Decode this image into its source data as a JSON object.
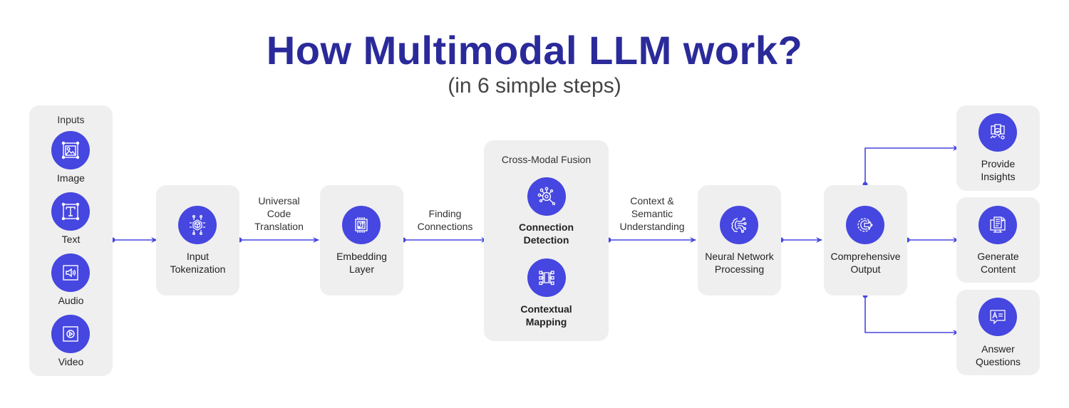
{
  "title": "How Multimodal LLM work?",
  "subtitle": "(in 6 simple steps)",
  "accent_color": "#4646e0",
  "title_color": "#2a2a9a",
  "inputs": {
    "header": "Inputs",
    "items": [
      {
        "label": "Image",
        "icon": "image-icon"
      },
      {
        "label": "Text",
        "icon": "text-icon"
      },
      {
        "label": "Audio",
        "icon": "audio-icon"
      },
      {
        "label": "Video",
        "icon": "video-icon"
      }
    ]
  },
  "steps": {
    "tokenization": {
      "line1": "Input",
      "line2": "Tokenization",
      "icon": "chip-cube-icon"
    },
    "embedding": {
      "line1": "Embedding",
      "line2": "Layer",
      "icon": "processor-icon"
    },
    "fusion": {
      "header": "Cross-Modal Fusion",
      "detection": {
        "line1": "Connection",
        "line2": "Detection",
        "icon": "network-search-icon"
      },
      "mapping": {
        "line1": "Contextual",
        "line2": "Mapping",
        "icon": "mapping-icon"
      }
    },
    "neural": {
      "line1": "Neural Network",
      "line2": "Processing",
      "icon": "neural-brain-icon"
    },
    "output": {
      "line1": "Comprehensive",
      "line2": "Output",
      "icon": "gear-arrow-icon"
    }
  },
  "edges": {
    "e1": {
      "line1": "Universal",
      "line2": "Code",
      "line3": "Translation"
    },
    "e2": {
      "line1": "Finding",
      "line2": "Connections"
    },
    "e3": {
      "line1": "Context &",
      "line2": "Semantic",
      "line3": "Understanding"
    }
  },
  "outcomes": [
    {
      "line1": "Provide",
      "line2": "Insights",
      "icon": "insights-icon"
    },
    {
      "line1": "Generate",
      "line2": "Content",
      "icon": "content-monitor-icon"
    },
    {
      "line1": "Answer",
      "line2": "Questions",
      "icon": "chat-answer-icon"
    }
  ]
}
